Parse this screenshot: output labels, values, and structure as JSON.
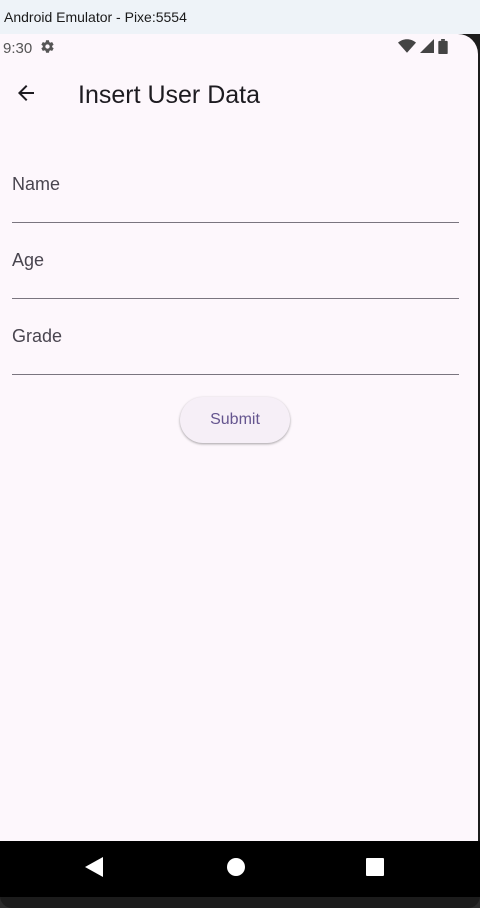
{
  "window": {
    "title": "Android Emulator - Pixe:5554"
  },
  "status_bar": {
    "time": "9:30",
    "icons": [
      "gear-icon",
      "wifi-icon",
      "signal-icon",
      "battery-icon"
    ]
  },
  "app_bar": {
    "back_icon": "arrow-back-icon",
    "title": "Insert User Data"
  },
  "form": {
    "fields": [
      {
        "label": "Name",
        "value": ""
      },
      {
        "label": "Age",
        "value": ""
      },
      {
        "label": "Grade",
        "value": ""
      }
    ],
    "submit_label": "Submit"
  },
  "nav_bar": {
    "buttons": [
      "back-triangle-icon",
      "home-circle-icon",
      "recents-square-icon"
    ]
  },
  "colors": {
    "screen_bg": "#fdf7fc",
    "accent": "#65558f",
    "button_bg": "#f6eff7",
    "underline": "#7a757f",
    "titlebar_bg": "#eef3f8"
  }
}
